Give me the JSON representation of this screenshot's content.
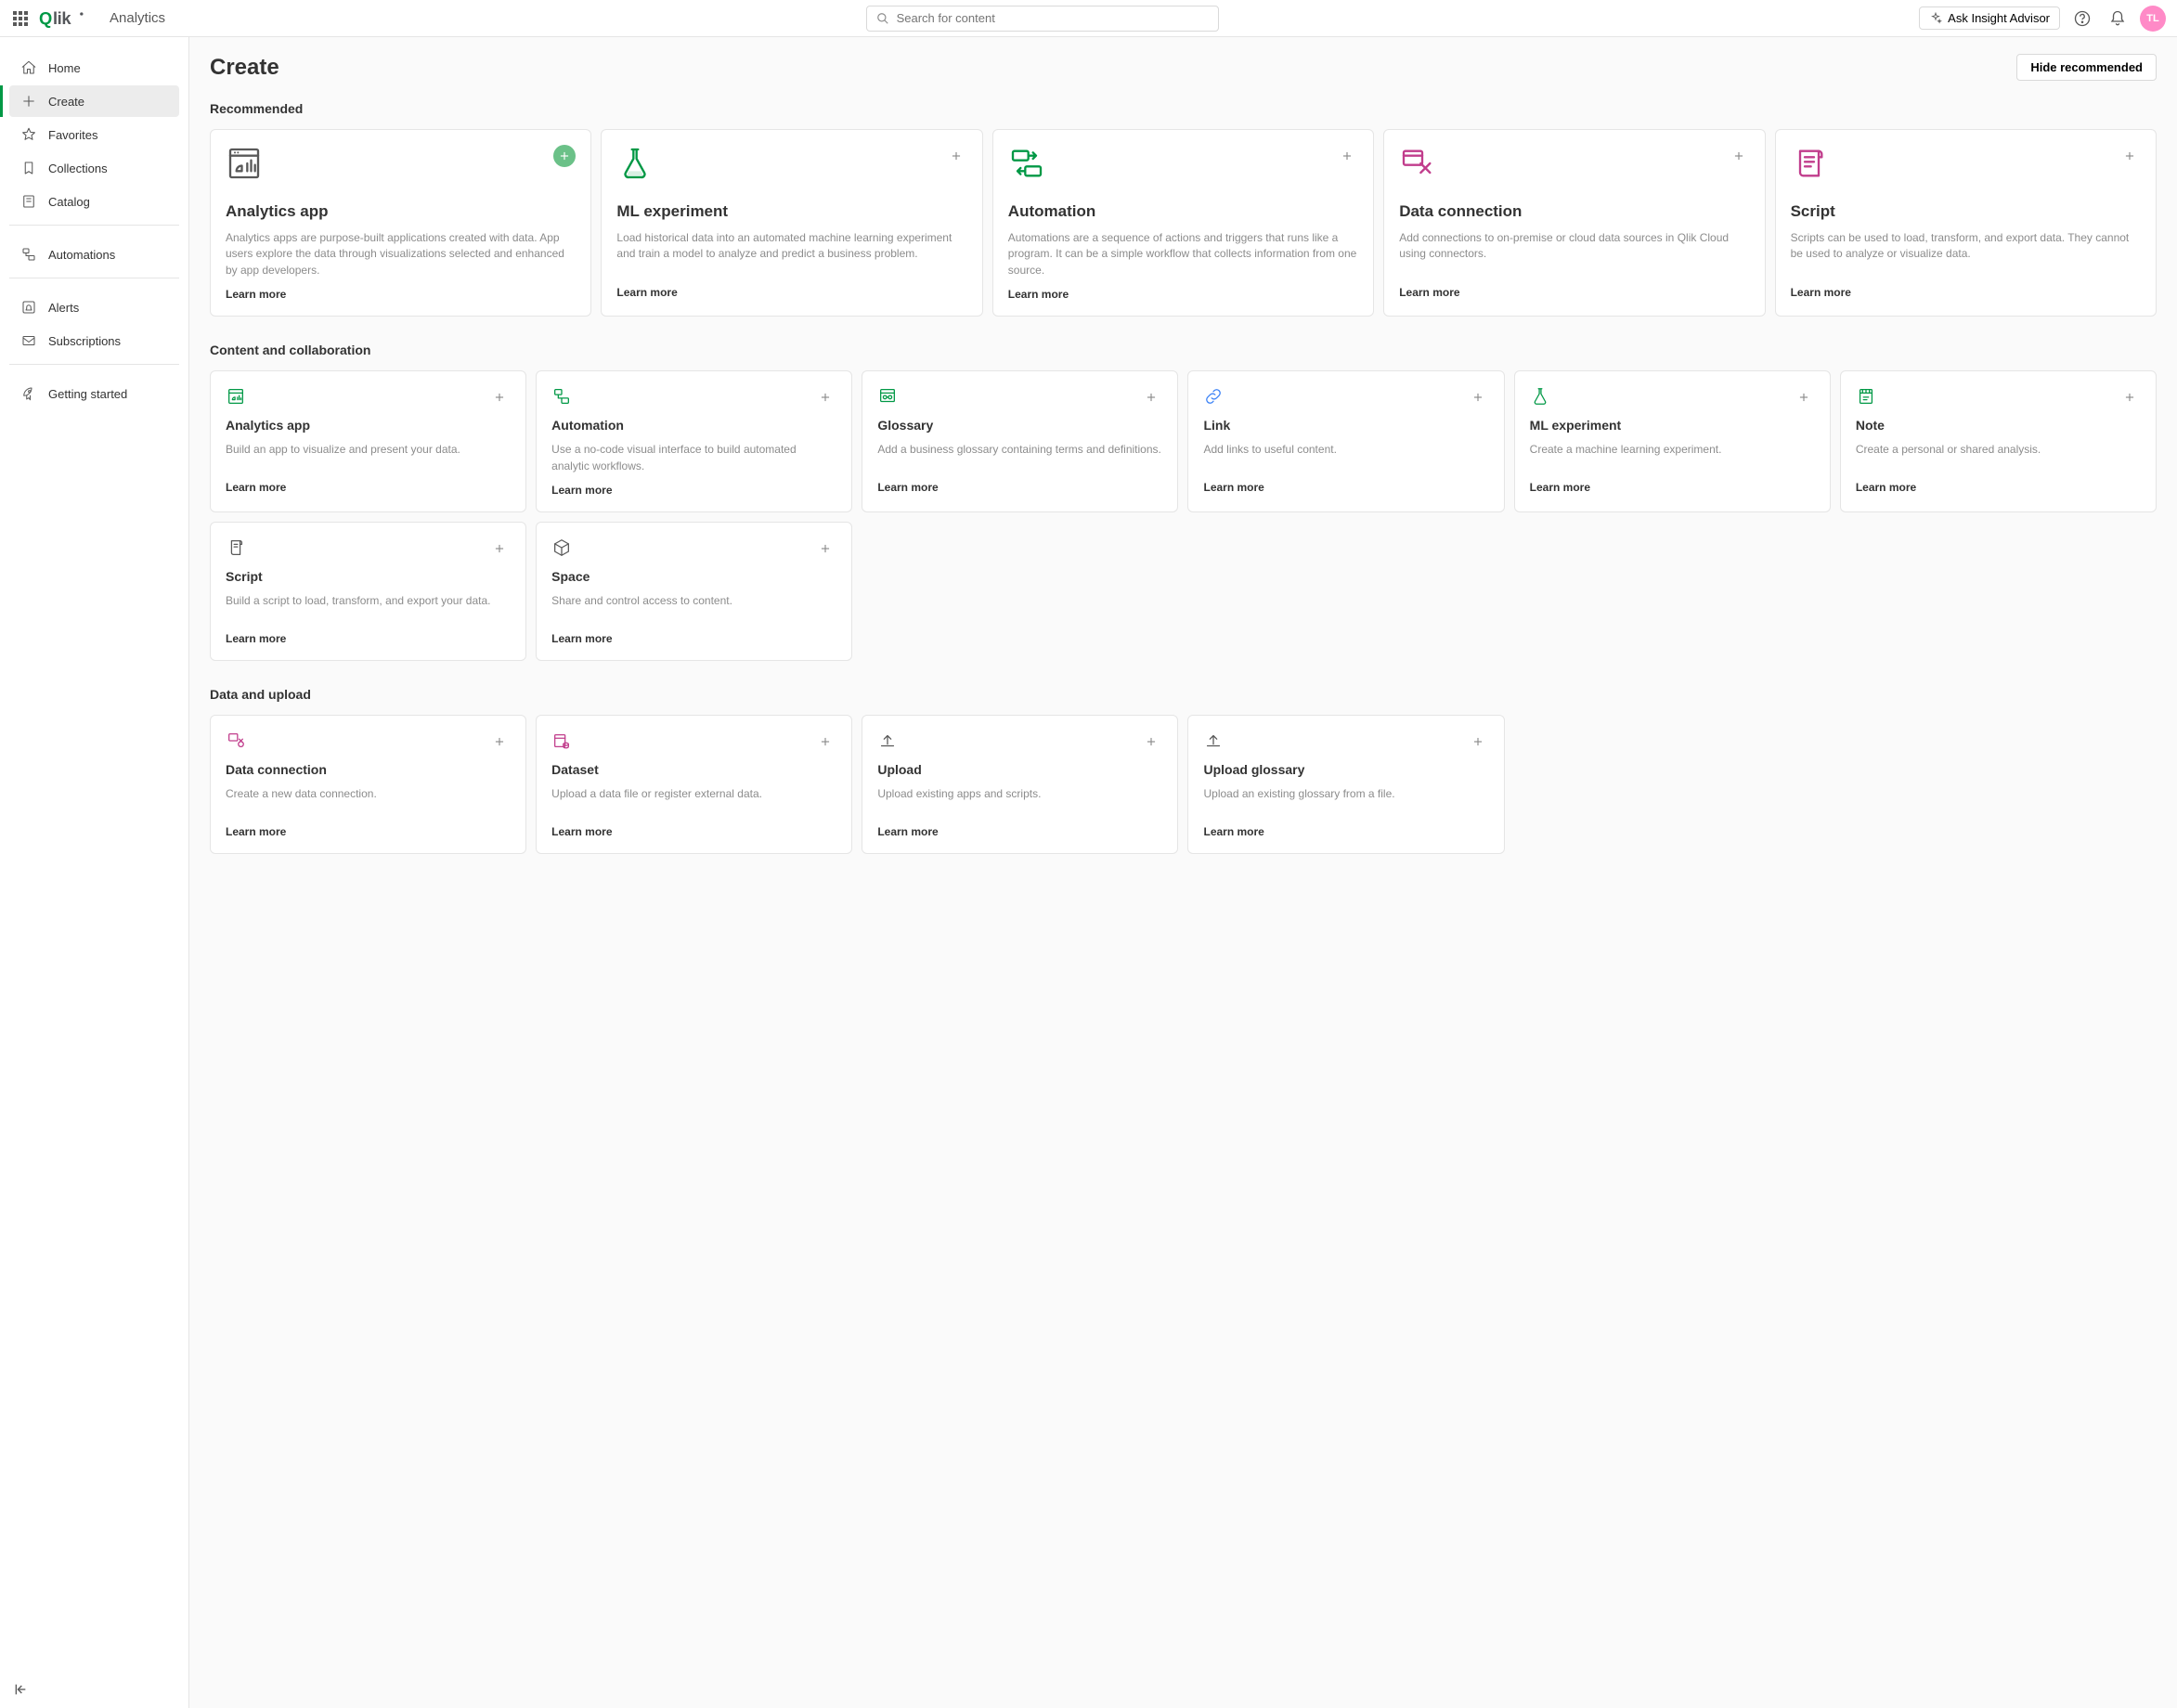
{
  "header": {
    "product": "Analytics",
    "search_placeholder": "Search for content",
    "ask_label": "Ask Insight Advisor",
    "avatar_initials": "TL"
  },
  "sidebar": {
    "groups": [
      {
        "items": [
          {
            "id": "home",
            "label": "Home",
            "icon": "home",
            "active": false
          },
          {
            "id": "create",
            "label": "Create",
            "icon": "plus",
            "active": true
          },
          {
            "id": "favorites",
            "label": "Favorites",
            "icon": "star",
            "active": false
          },
          {
            "id": "collections",
            "label": "Collections",
            "icon": "bookmark",
            "active": false
          },
          {
            "id": "catalog",
            "label": "Catalog",
            "icon": "catalog",
            "active": false
          }
        ]
      },
      {
        "items": [
          {
            "id": "automations",
            "label": "Automations",
            "icon": "automation",
            "active": false
          }
        ]
      },
      {
        "items": [
          {
            "id": "alerts",
            "label": "Alerts",
            "icon": "bell-square",
            "active": false
          },
          {
            "id": "subscriptions",
            "label": "Subscriptions",
            "icon": "mail",
            "active": false
          }
        ]
      },
      {
        "items": [
          {
            "id": "getting-started",
            "label": "Getting started",
            "icon": "rocket",
            "active": false
          }
        ]
      }
    ]
  },
  "main": {
    "title": "Create",
    "hide_label": "Hide recommended",
    "sections": [
      {
        "id": "recommended",
        "title": "Recommended",
        "layout": "recommended-row",
        "card_size": "large",
        "cards": [
          {
            "id": "analytics-app",
            "title": "Analytics app",
            "desc": "Analytics apps are purpose-built applications created with data. App users explore the data through visualizations selected and enhanced by app developers.",
            "learn": "Learn more",
            "icon": "analytics-app-large",
            "icon_color": "#595959",
            "add_green": true
          },
          {
            "id": "ml-experiment",
            "title": "ML experiment",
            "desc": "Load historical data into an automated machine learning experiment and train a model to analyze and predict a business problem.",
            "learn": "Learn more",
            "icon": "flask-large",
            "icon_color": "#009845",
            "add_green": false
          },
          {
            "id": "automation",
            "title": "Automation",
            "desc": "Automations are a sequence of actions and triggers that runs like a program. It can be a simple workflow that collects information from one source.",
            "learn": "Learn more",
            "icon": "automation-large",
            "icon_color": "#009845",
            "add_green": false
          },
          {
            "id": "data-connection",
            "title": "Data connection",
            "desc": "Add connections to on-premise or cloud data sources in Qlik Cloud using connectors.",
            "learn": "Learn more",
            "icon": "data-connection-large",
            "icon_color": "#c13d8c",
            "add_green": false
          },
          {
            "id": "script",
            "title": "Script",
            "desc": "Scripts can be used to load, transform, and export data. They cannot be used to analyze or visualize data.",
            "learn": "Learn more",
            "icon": "script-large",
            "icon_color": "#c13d8c",
            "add_green": false
          }
        ]
      },
      {
        "id": "content-collab",
        "title": "Content and collaboration",
        "layout": "content-row",
        "card_size": "small",
        "cards": [
          {
            "id": "cc-analytics-app",
            "title": "Analytics app",
            "desc": "Build an app to visualize and present your data.",
            "learn": "Learn more",
            "icon": "analytics-app",
            "icon_color": "#009845"
          },
          {
            "id": "cc-automation",
            "title": "Automation",
            "desc": "Use a no-code visual interface to build automated analytic workflows.",
            "learn": "Learn more",
            "icon": "automation",
            "icon_color": "#009845"
          },
          {
            "id": "cc-glossary",
            "title": "Glossary",
            "desc": "Add a business glossary containing terms and definitions.",
            "learn": "Learn more",
            "icon": "glossary",
            "icon_color": "#009845"
          },
          {
            "id": "cc-link",
            "title": "Link",
            "desc": "Add links to useful content.",
            "learn": "Learn more",
            "icon": "link",
            "icon_color": "#3b82f6"
          },
          {
            "id": "cc-ml",
            "title": "ML experiment",
            "desc": "Create a machine learning experiment.",
            "learn": "Learn more",
            "icon": "flask",
            "icon_color": "#009845"
          },
          {
            "id": "cc-note",
            "title": "Note",
            "desc": "Create a personal or shared analysis.",
            "learn": "Learn more",
            "icon": "note",
            "icon_color": "#009845"
          },
          {
            "id": "cc-script",
            "title": "Script",
            "desc": "Build a script to load, transform, and export your data.",
            "learn": "Learn more",
            "icon": "script",
            "icon_color": "#595959"
          },
          {
            "id": "cc-space",
            "title": "Space",
            "desc": "Share and control access to content.",
            "learn": "Learn more",
            "icon": "cube",
            "icon_color": "#595959"
          }
        ]
      },
      {
        "id": "data-upload",
        "title": "Data and upload",
        "layout": "content-row",
        "card_size": "small",
        "cards": [
          {
            "id": "du-dataconn",
            "title": "Data connection",
            "desc": "Create a new data connection.",
            "learn": "Learn more",
            "icon": "data-connection",
            "icon_color": "#c13d8c"
          },
          {
            "id": "du-dataset",
            "title": "Dataset",
            "desc": "Upload a data file or register external data.",
            "learn": "Learn more",
            "icon": "dataset",
            "icon_color": "#c13d8c"
          },
          {
            "id": "du-upload",
            "title": "Upload",
            "desc": "Upload existing apps and scripts.",
            "learn": "Learn more",
            "icon": "upload",
            "icon_color": "#595959"
          },
          {
            "id": "du-upload-glossary",
            "title": "Upload glossary",
            "desc": "Upload an existing glossary from a file.",
            "learn": "Learn more",
            "icon": "upload",
            "icon_color": "#595959"
          }
        ]
      }
    ]
  }
}
